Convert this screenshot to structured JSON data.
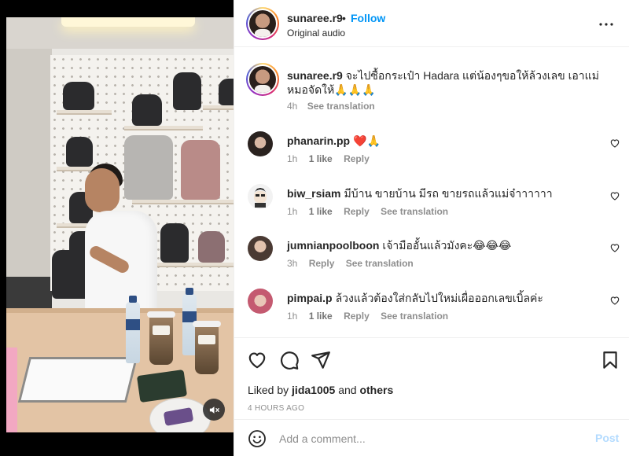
{
  "media": {
    "mute_icon": "speaker-muted-icon"
  },
  "header": {
    "username": "sunaree.r9",
    "separator": "•",
    "follow_label": "Follow",
    "audio_label": "Original audio",
    "more_icon": "more-horizontal-icon"
  },
  "caption": {
    "username": "sunaree.r9",
    "text": "จะไปซื้อกระเป๋า Hadara แต่น้องๆขอให้ล้วงเลข เอาแม่หมอจัดให้🙏🙏🙏",
    "time": "4h",
    "see_translation": "See translation"
  },
  "comments": [
    {
      "username": "phanarin.pp",
      "text": "❤️🙏",
      "time": "1h",
      "likes": "1 like",
      "reply": "Reply",
      "see_translation": ""
    },
    {
      "username": "biw_rsiam",
      "text": "มีบ้าน ขายบ้าน มีรถ ขายรถแล้วแม่จ๋าาาาาา",
      "time": "1h",
      "likes": "1 like",
      "reply": "Reply",
      "see_translation": "See translation"
    },
    {
      "username": "jumnianpoolboon",
      "text": "เจ้ามืออั้นแล้วมังคะ😂😂😂",
      "time": "3h",
      "likes": "",
      "reply": "Reply",
      "see_translation": "See translation"
    },
    {
      "username": "pimpai.p",
      "text": "ล้วงแล้วต้องใส่กลับไปใหม่เผื่อออกเลขเบิ้ลค่ะ",
      "time": "1h",
      "likes": "1 like",
      "reply": "Reply",
      "see_translation": "See translation"
    }
  ],
  "actions": {
    "like_icon": "heart-icon",
    "comment_icon": "comment-bubble-icon",
    "share_icon": "paper-plane-icon",
    "save_icon": "bookmark-icon",
    "liked_by_prefix": "Liked by",
    "liked_by_user": "jida1005",
    "liked_by_and": "and",
    "liked_by_others": "others",
    "timestamp": "4 HOURS AGO"
  },
  "add_comment": {
    "emoji_icon": "smiley-icon",
    "placeholder": "Add a comment...",
    "post_label": "Post"
  },
  "colors": {
    "accent": "#0095f6",
    "post_disabled": "#b3dbff",
    "secondary_text": "#8e8e8e",
    "heart_red": "#ed4956"
  }
}
